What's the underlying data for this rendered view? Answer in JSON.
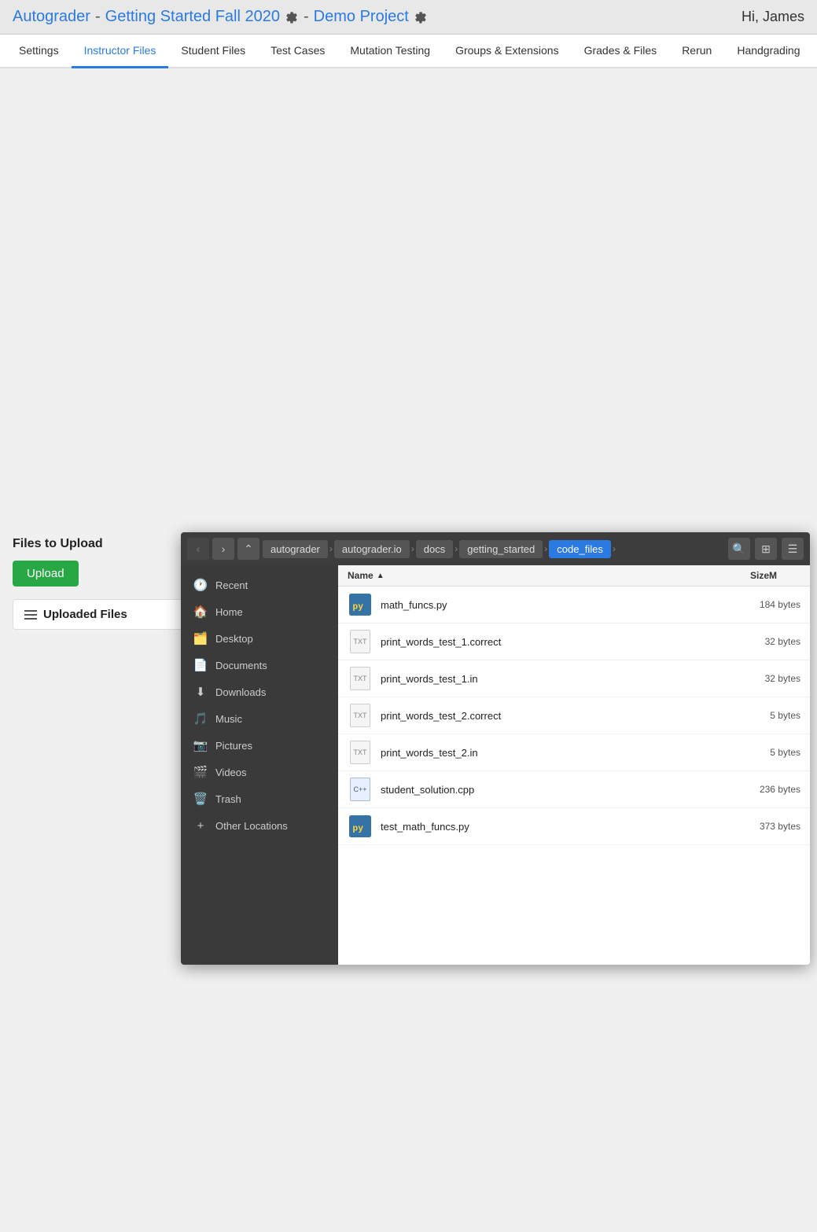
{
  "header": {
    "title_link1": "Autograder",
    "sep1": " - ",
    "title_link2": "Getting Started Fall 2020",
    "sep2": " - ",
    "title_link3": "Demo Project",
    "greeting": "Hi, James"
  },
  "nav": {
    "tabs": [
      {
        "label": "Settings",
        "active": false
      },
      {
        "label": "Instructor Files",
        "active": true
      },
      {
        "label": "Student Files",
        "active": false
      },
      {
        "label": "Test Cases",
        "active": false
      },
      {
        "label": "Mutation Testing",
        "active": false
      },
      {
        "label": "Groups & Extensions",
        "active": false
      },
      {
        "label": "Grades & Files",
        "active": false
      },
      {
        "label": "Rerun",
        "active": false
      },
      {
        "label": "Handgrading",
        "active": false
      }
    ]
  },
  "file_dialog": {
    "breadcrumbs": [
      {
        "label": "autograder",
        "active": false
      },
      {
        "label": "autograder.io",
        "active": false
      },
      {
        "label": "docs",
        "active": false
      },
      {
        "label": "getting_started",
        "active": false
      },
      {
        "label": "code_files",
        "active": true
      }
    ],
    "sidebar": [
      {
        "icon": "🕐",
        "label": "Recent"
      },
      {
        "icon": "🏠",
        "label": "Home"
      },
      {
        "icon": "🗂️",
        "label": "Desktop"
      },
      {
        "icon": "📄",
        "label": "Documents"
      },
      {
        "icon": "⬇",
        "label": "Downloads"
      },
      {
        "icon": "🎵",
        "label": "Music"
      },
      {
        "icon": "📷",
        "label": "Pictures"
      },
      {
        "icon": "🎬",
        "label": "Videos"
      },
      {
        "icon": "🗑️",
        "label": "Trash"
      },
      {
        "icon": "+",
        "label": "Other Locations"
      }
    ],
    "columns": {
      "name": "Name",
      "size": "Size",
      "modified": "M"
    },
    "files": [
      {
        "name": "math_funcs.py",
        "type": "py",
        "size": "184 bytes"
      },
      {
        "name": "print_words_test_1.correct",
        "type": "txt",
        "size": "32 bytes"
      },
      {
        "name": "print_words_test_1.in",
        "type": "txt",
        "size": "32 bytes"
      },
      {
        "name": "print_words_test_2.correct",
        "type": "txt",
        "size": "5 bytes"
      },
      {
        "name": "print_words_test_2.in",
        "type": "txt",
        "size": "5 bytes"
      },
      {
        "name": "student_solution.cpp",
        "type": "cpp",
        "size": "236 bytes"
      },
      {
        "name": "test_math_funcs.py",
        "type": "py",
        "size": "373 bytes"
      }
    ]
  },
  "bottom": {
    "files_to_upload_label": "Files to Upload",
    "upload_button_label": "Upload",
    "uploaded_files_header": "Uploaded Files"
  }
}
